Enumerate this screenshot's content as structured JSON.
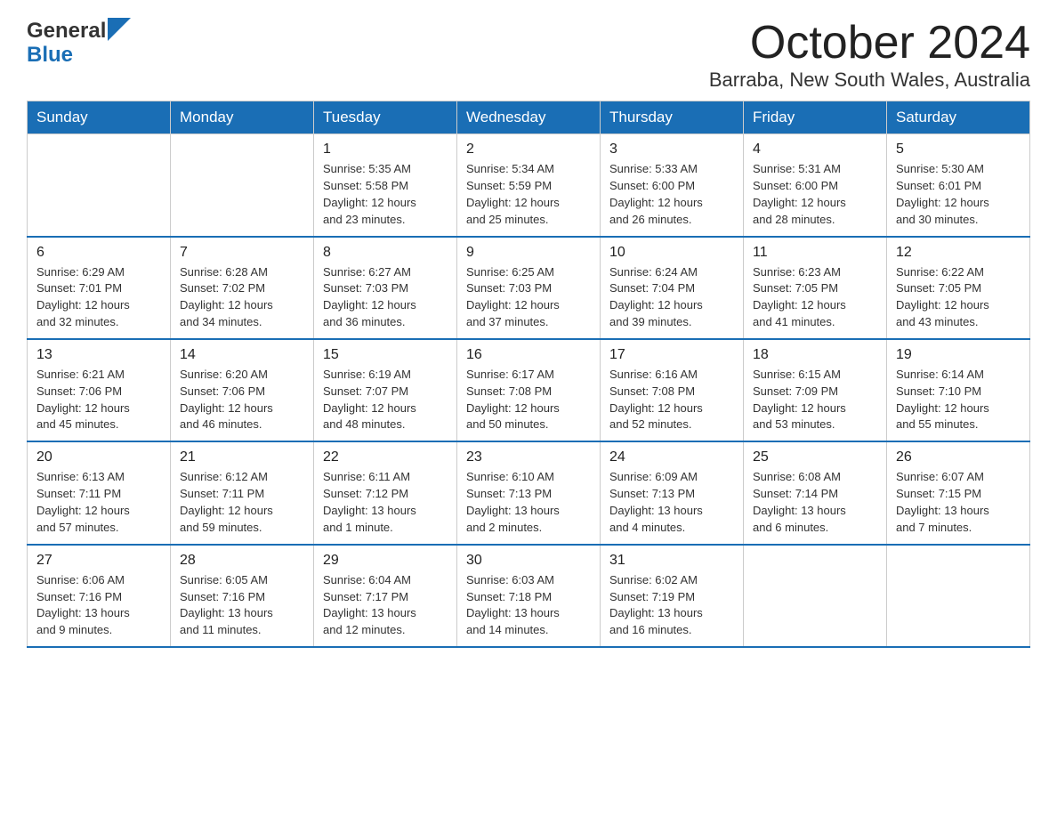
{
  "header": {
    "logo_general": "General",
    "logo_blue": "Blue",
    "month_title": "October 2024",
    "location": "Barraba, New South Wales, Australia"
  },
  "days_of_week": [
    "Sunday",
    "Monday",
    "Tuesday",
    "Wednesday",
    "Thursday",
    "Friday",
    "Saturday"
  ],
  "weeks": [
    [
      {
        "day": "",
        "info": ""
      },
      {
        "day": "",
        "info": ""
      },
      {
        "day": "1",
        "info": "Sunrise: 5:35 AM\nSunset: 5:58 PM\nDaylight: 12 hours\nand 23 minutes."
      },
      {
        "day": "2",
        "info": "Sunrise: 5:34 AM\nSunset: 5:59 PM\nDaylight: 12 hours\nand 25 minutes."
      },
      {
        "day": "3",
        "info": "Sunrise: 5:33 AM\nSunset: 6:00 PM\nDaylight: 12 hours\nand 26 minutes."
      },
      {
        "day": "4",
        "info": "Sunrise: 5:31 AM\nSunset: 6:00 PM\nDaylight: 12 hours\nand 28 minutes."
      },
      {
        "day": "5",
        "info": "Sunrise: 5:30 AM\nSunset: 6:01 PM\nDaylight: 12 hours\nand 30 minutes."
      }
    ],
    [
      {
        "day": "6",
        "info": "Sunrise: 6:29 AM\nSunset: 7:01 PM\nDaylight: 12 hours\nand 32 minutes."
      },
      {
        "day": "7",
        "info": "Sunrise: 6:28 AM\nSunset: 7:02 PM\nDaylight: 12 hours\nand 34 minutes."
      },
      {
        "day": "8",
        "info": "Sunrise: 6:27 AM\nSunset: 7:03 PM\nDaylight: 12 hours\nand 36 minutes."
      },
      {
        "day": "9",
        "info": "Sunrise: 6:25 AM\nSunset: 7:03 PM\nDaylight: 12 hours\nand 37 minutes."
      },
      {
        "day": "10",
        "info": "Sunrise: 6:24 AM\nSunset: 7:04 PM\nDaylight: 12 hours\nand 39 minutes."
      },
      {
        "day": "11",
        "info": "Sunrise: 6:23 AM\nSunset: 7:05 PM\nDaylight: 12 hours\nand 41 minutes."
      },
      {
        "day": "12",
        "info": "Sunrise: 6:22 AM\nSunset: 7:05 PM\nDaylight: 12 hours\nand 43 minutes."
      }
    ],
    [
      {
        "day": "13",
        "info": "Sunrise: 6:21 AM\nSunset: 7:06 PM\nDaylight: 12 hours\nand 45 minutes."
      },
      {
        "day": "14",
        "info": "Sunrise: 6:20 AM\nSunset: 7:06 PM\nDaylight: 12 hours\nand 46 minutes."
      },
      {
        "day": "15",
        "info": "Sunrise: 6:19 AM\nSunset: 7:07 PM\nDaylight: 12 hours\nand 48 minutes."
      },
      {
        "day": "16",
        "info": "Sunrise: 6:17 AM\nSunset: 7:08 PM\nDaylight: 12 hours\nand 50 minutes."
      },
      {
        "day": "17",
        "info": "Sunrise: 6:16 AM\nSunset: 7:08 PM\nDaylight: 12 hours\nand 52 minutes."
      },
      {
        "day": "18",
        "info": "Sunrise: 6:15 AM\nSunset: 7:09 PM\nDaylight: 12 hours\nand 53 minutes."
      },
      {
        "day": "19",
        "info": "Sunrise: 6:14 AM\nSunset: 7:10 PM\nDaylight: 12 hours\nand 55 minutes."
      }
    ],
    [
      {
        "day": "20",
        "info": "Sunrise: 6:13 AM\nSunset: 7:11 PM\nDaylight: 12 hours\nand 57 minutes."
      },
      {
        "day": "21",
        "info": "Sunrise: 6:12 AM\nSunset: 7:11 PM\nDaylight: 12 hours\nand 59 minutes."
      },
      {
        "day": "22",
        "info": "Sunrise: 6:11 AM\nSunset: 7:12 PM\nDaylight: 13 hours\nand 1 minute."
      },
      {
        "day": "23",
        "info": "Sunrise: 6:10 AM\nSunset: 7:13 PM\nDaylight: 13 hours\nand 2 minutes."
      },
      {
        "day": "24",
        "info": "Sunrise: 6:09 AM\nSunset: 7:13 PM\nDaylight: 13 hours\nand 4 minutes."
      },
      {
        "day": "25",
        "info": "Sunrise: 6:08 AM\nSunset: 7:14 PM\nDaylight: 13 hours\nand 6 minutes."
      },
      {
        "day": "26",
        "info": "Sunrise: 6:07 AM\nSunset: 7:15 PM\nDaylight: 13 hours\nand 7 minutes."
      }
    ],
    [
      {
        "day": "27",
        "info": "Sunrise: 6:06 AM\nSunset: 7:16 PM\nDaylight: 13 hours\nand 9 minutes."
      },
      {
        "day": "28",
        "info": "Sunrise: 6:05 AM\nSunset: 7:16 PM\nDaylight: 13 hours\nand 11 minutes."
      },
      {
        "day": "29",
        "info": "Sunrise: 6:04 AM\nSunset: 7:17 PM\nDaylight: 13 hours\nand 12 minutes."
      },
      {
        "day": "30",
        "info": "Sunrise: 6:03 AM\nSunset: 7:18 PM\nDaylight: 13 hours\nand 14 minutes."
      },
      {
        "day": "31",
        "info": "Sunrise: 6:02 AM\nSunset: 7:19 PM\nDaylight: 13 hours\nand 16 minutes."
      },
      {
        "day": "",
        "info": ""
      },
      {
        "day": "",
        "info": ""
      }
    ]
  ]
}
